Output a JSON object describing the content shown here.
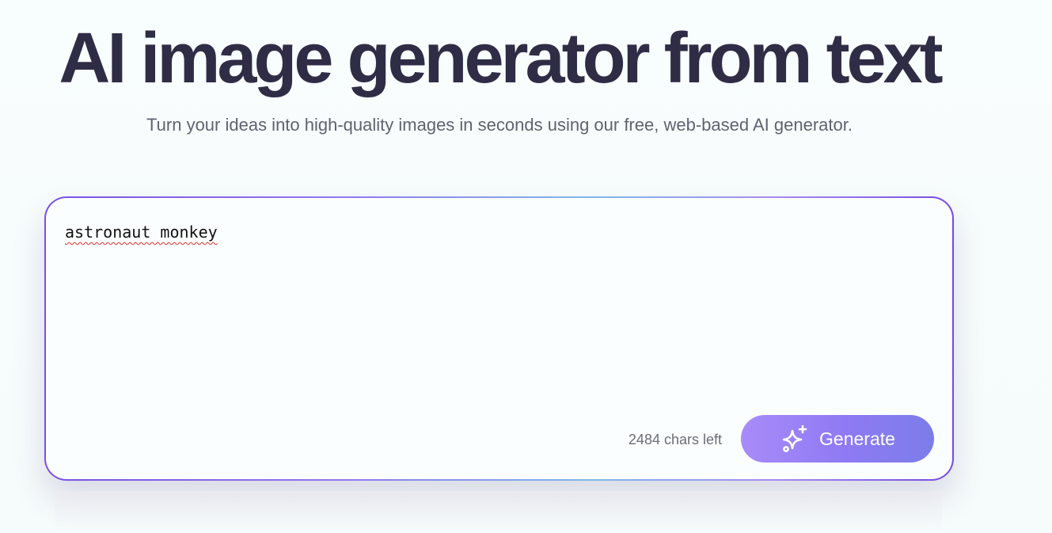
{
  "hero": {
    "title": "AI image generator from text",
    "subtitle": "Turn your ideas into high-quality images in seconds using our free, web-based AI generator."
  },
  "prompt": {
    "value": "astronaut monkey",
    "chars_left": "2484 chars left"
  },
  "generate_button": {
    "label": "Generate",
    "icon": "sparkle-icon"
  },
  "colors": {
    "title": "#2f2d46",
    "subtitle": "#5f6370",
    "accent_start": "#a88bf8",
    "accent_end": "#7c7de9",
    "border_violet": "#7a4fe6",
    "spellcheck_underline": "#e0302a"
  }
}
